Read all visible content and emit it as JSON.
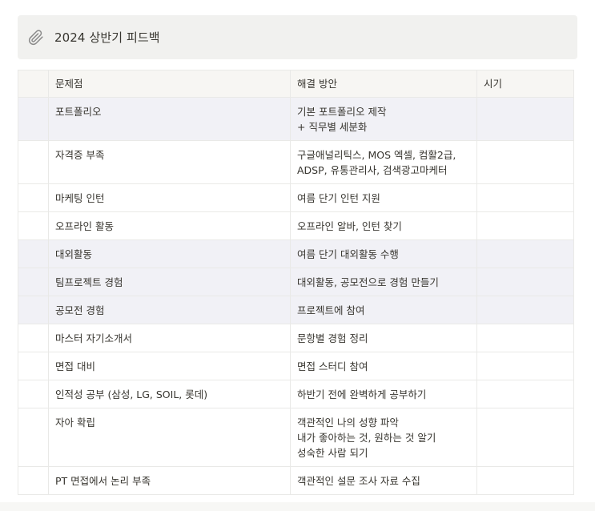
{
  "callout": {
    "icon": "paperclip-icon",
    "title": "2024 상반기 피드백"
  },
  "table": {
    "columns": [
      "문제점",
      "해결 방안",
      "시기"
    ],
    "rows": [
      {
        "problem": "포트폴리오",
        "solution": [
          "기본 포트폴리오 제작",
          "+ 직무별 세분화"
        ],
        "timing": "",
        "highlighted": true
      },
      {
        "problem": "자격증 부족",
        "solution": [
          "구글애널리틱스, MOS 엑셀, 컴활2급,",
          "ADSP, 유통관리사, 검색광고마케터"
        ],
        "timing": "",
        "highlighted": false
      },
      {
        "problem": "마케팅 인턴",
        "solution": [
          "여름 단기 인턴 지원"
        ],
        "timing": "",
        "highlighted": false
      },
      {
        "problem": "오프라인 활동",
        "solution": [
          "오프라인 알바, 인턴 찾기"
        ],
        "timing": "",
        "highlighted": false
      },
      {
        "problem": "대외활동",
        "solution": [
          "여름 단기 대외활동 수행"
        ],
        "timing": "",
        "highlighted": true
      },
      {
        "problem": "팀프로젝트 경험",
        "solution": [
          "대외활동, 공모전으로 경험 만들기"
        ],
        "timing": "",
        "highlighted": true
      },
      {
        "problem": "공모전 경험",
        "solution": [
          "프로젝트에 참여"
        ],
        "timing": "",
        "highlighted": true
      },
      {
        "problem": "마스터 자기소개서",
        "solution": [
          "문항별 경험 정리"
        ],
        "timing": "",
        "highlighted": false
      },
      {
        "problem": "면접 대비",
        "solution": [
          "면접 스터디 참여"
        ],
        "timing": "",
        "highlighted": false
      },
      {
        "problem": "인적성 공부 (삼성, LG, SOIL, 롯데)",
        "solution": [
          "하반기 전에 완벽하게 공부하기"
        ],
        "timing": "",
        "highlighted": false
      },
      {
        "problem": "자아 확립",
        "solution": [
          "객관적인 나의 성향 파악",
          "내가 좋아하는 것, 원하는 것 알기",
          "성숙한 사람 되기"
        ],
        "timing": "",
        "highlighted": false
      },
      {
        "problem": "PT 면접에서 논리 부족",
        "solution": [
          "객관적인 설문 조사 자료 수집"
        ],
        "timing": "",
        "highlighted": false
      }
    ]
  },
  "colors": {
    "callout_bg": "#f1f1ef",
    "header_bg": "#f7f6f3",
    "highlight_row_bg": "#f1f1f6",
    "border": "#e9e9e7",
    "text": "#37352f"
  }
}
